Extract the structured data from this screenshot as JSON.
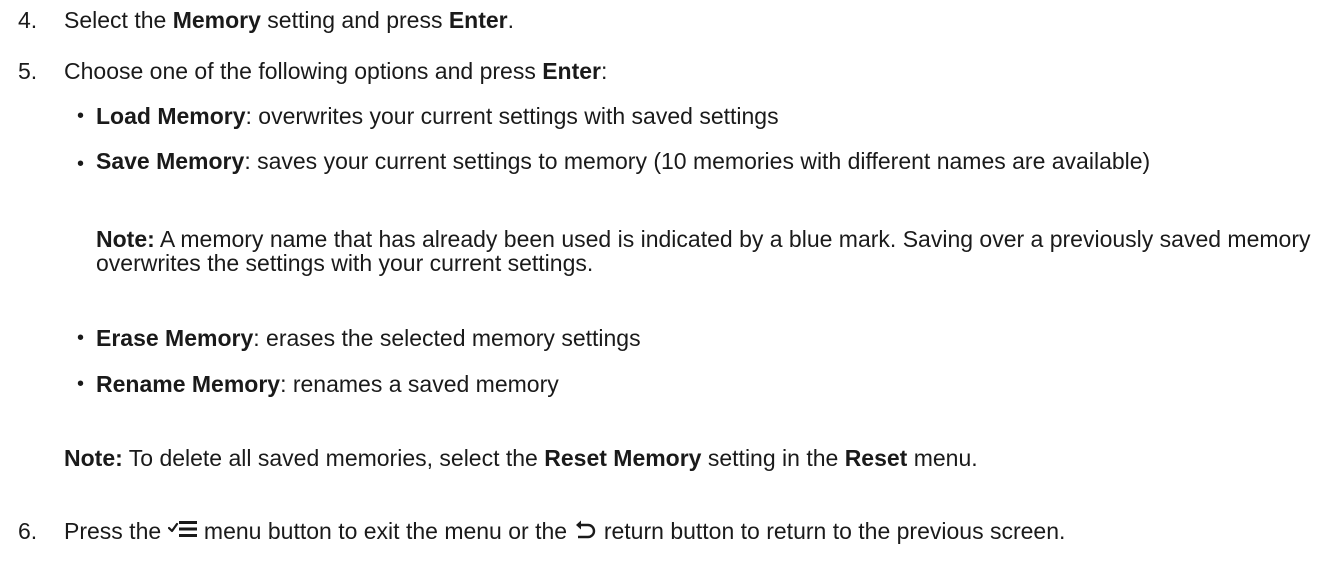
{
  "steps": {
    "s4": {
      "number": "4.",
      "pre": "Select the ",
      "bold1": "Memory",
      "mid": " setting and press ",
      "bold2": "Enter",
      "post": "."
    },
    "s5": {
      "number": "5.",
      "pre": "Choose one of the following options and press ",
      "bold1": "Enter",
      "post": ":"
    },
    "s6": {
      "number": "6.",
      "pre": "Press the ",
      "mid1": " menu button to exit the menu or the ",
      "mid2": " return button to return to the previous screen.",
      "icons": [
        "menu-icon",
        "return-icon"
      ]
    }
  },
  "options": [
    {
      "bullet": "•",
      "title": "Load Memory",
      "desc": ": overwrites your current settings with saved settings"
    },
    {
      "bullet": "•",
      "title": "Save Memory",
      "desc": ": saves your current settings to memory (10 memories with different names are available)"
    },
    {
      "bullet": "•",
      "title": "Erase Memory",
      "desc": ": erases the selected memory settings"
    },
    {
      "bullet": "•",
      "title": "Rename Memory",
      "desc": ": renames a saved memory"
    }
  ],
  "note_save": {
    "label": "Note:",
    "text": " A memory name that has already been used is indicated by a blue mark. Saving over a previously saved memory overwrites the settings with your current settings."
  },
  "note_reset": {
    "label": "Note:",
    "pre": " To delete all saved memories, select the ",
    "bold1": "Reset Memory",
    "mid": " setting in the ",
    "bold2": "Reset",
    "post": " menu."
  }
}
